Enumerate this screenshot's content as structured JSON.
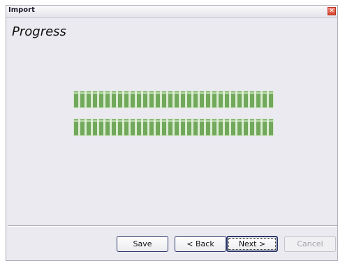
{
  "window": {
    "title": "Import",
    "close_glyph": "✕"
  },
  "page": {
    "heading": "Progress"
  },
  "progress": [
    {
      "fraction": 1.0
    },
    {
      "fraction": 1.0
    }
  ],
  "buttons": {
    "save": "Save",
    "back": "< Back",
    "next": "Next >",
    "cancel": "Cancel"
  },
  "colors": {
    "progress_fill": "#71a85c",
    "dialog_background": "#ebeaf0"
  }
}
